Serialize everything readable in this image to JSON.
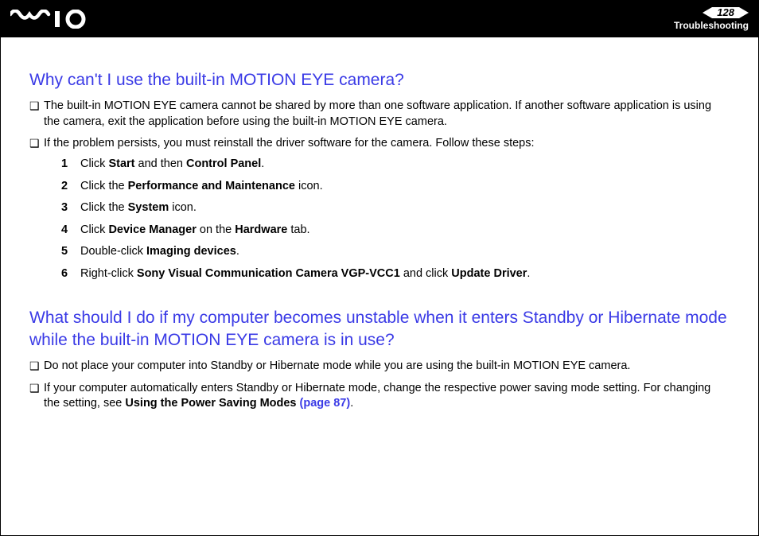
{
  "header": {
    "page_number": "128",
    "section": "Troubleshooting"
  },
  "section1": {
    "heading": "Why can't I use the built-in MOTION EYE camera?",
    "bullet1": "The built-in MOTION EYE camera cannot be shared by more than one software application. If another software application is using the camera, exit the application before using the built-in MOTION EYE camera.",
    "bullet2": "If the problem persists, you must reinstall the driver software for the camera. Follow these steps:",
    "steps": {
      "s1a": "Click ",
      "s1b": "Start",
      "s1c": " and then ",
      "s1d": "Control Panel",
      "s1e": ".",
      "s2a": "Click the ",
      "s2b": "Performance and Maintenance",
      "s2c": " icon.",
      "s3a": "Click the ",
      "s3b": "System",
      "s3c": " icon.",
      "s4a": "Click ",
      "s4b": "Device Manager",
      "s4c": " on the ",
      "s4d": "Hardware",
      "s4e": " tab.",
      "s5a": "Double-click ",
      "s5b": "Imaging devices",
      "s5c": ".",
      "s6a": "Right-click ",
      "s6b": "Sony Visual Communication Camera VGP-VCC1",
      "s6c": " and click ",
      "s6d": "Update Driver",
      "s6e": "."
    }
  },
  "section2": {
    "heading": "What should I do if my computer becomes unstable when it enters Standby or Hibernate mode while the built-in MOTION EYE camera is in use?",
    "bullet1": "Do not place your computer into Standby or Hibernate mode while you are using the built-in MOTION EYE camera.",
    "bullet2a": "If your computer automatically enters Standby or Hibernate mode, change the respective power saving mode setting. For changing the setting, see ",
    "bullet2b": "Using the Power Saving Modes ",
    "bullet2c": "(page 87)",
    "bullet2d": "."
  }
}
